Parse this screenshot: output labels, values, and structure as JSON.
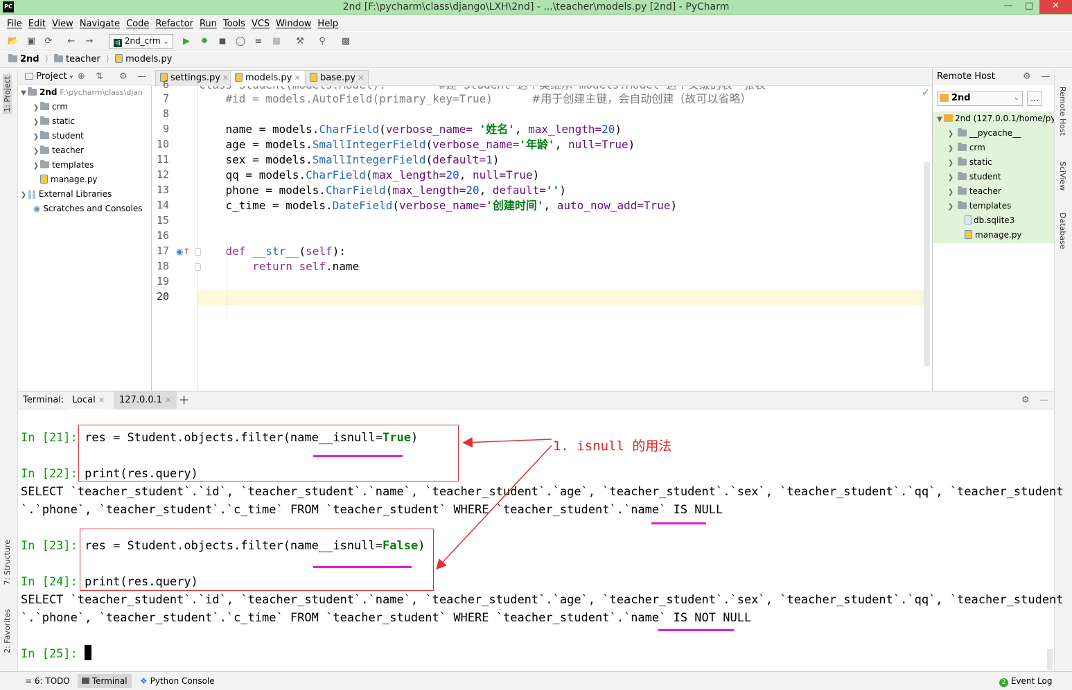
{
  "window": {
    "title": "2nd [F:\\pycharm\\class\\django\\LXH\\2nd] - ...\\teacher\\models.py [2nd] - PyCharm",
    "logo": "PC"
  },
  "menu": [
    "File",
    "Edit",
    "View",
    "Navigate",
    "Code",
    "Refactor",
    "Run",
    "Tools",
    "VCS",
    "Window",
    "Help"
  ],
  "toolbar": {
    "run_config": "2nd_crm"
  },
  "breadcrumb": [
    "2nd",
    "teacher",
    "models.py"
  ],
  "left_tool_tabs": [
    "1: Project",
    "7: Structure",
    "2: Favorites"
  ],
  "right_tool_tabs": [
    "Remote Host",
    "SciView",
    "Database"
  ],
  "project": {
    "header": "Project",
    "root": {
      "name": "2nd",
      "path": "F:\\pycharm\\class\\djan"
    },
    "items": [
      {
        "name": "crm",
        "type": "folder"
      },
      {
        "name": "static",
        "type": "folder"
      },
      {
        "name": "student",
        "type": "folder"
      },
      {
        "name": "teacher",
        "type": "folder"
      },
      {
        "name": "templates",
        "type": "folder"
      },
      {
        "name": "manage.py",
        "type": "file"
      }
    ],
    "external_libraries": "External Libraries",
    "scratches": "Scratches and Consoles"
  },
  "editor": {
    "tabs": [
      {
        "label": "settings.py",
        "active": false
      },
      {
        "label": "models.py",
        "active": true
      },
      {
        "label": "base.py",
        "active": false
      }
    ],
    "top_partial_line": "class Student(models.Model):        #建 Student 这个类继承 models.Model 这个父级的表一张表",
    "top_partial_number": "6",
    "line_numbers": [
      "7",
      "8",
      "9",
      "10",
      "11",
      "12",
      "13",
      "14",
      "15",
      "16",
      "17",
      "18",
      "19",
      "20"
    ],
    "lines": {
      "l7a": "    #id = models.AutoField(primary_key=True)",
      "l7b": "#用于创建主键，会自动创建（故可以省略）",
      "l9": [
        "    name = models.",
        "CharField",
        "(",
        "verbose_name=",
        " ",
        "'姓名'",
        ", ",
        "max_length=",
        "20",
        ")"
      ],
      "l10": [
        "    age = models.",
        "SmallIntegerField",
        "(",
        "verbose_name=",
        "'年龄'",
        ", ",
        "null=",
        "True",
        ")"
      ],
      "l11": [
        "    sex = models.",
        "SmallIntegerField",
        "(",
        "default=",
        "1",
        ")"
      ],
      "l12": [
        "    qq = models.",
        "CharField",
        "(",
        "max_length=",
        "20",
        ", ",
        "null=",
        "True",
        ")"
      ],
      "l13": [
        "    phone = models.",
        "CharField",
        "(",
        "max_length=",
        "20",
        ", ",
        "default=",
        "''",
        ")"
      ],
      "l14": [
        "    c_time = models.",
        "DateField",
        "(",
        "verbose_name=",
        "'创建时间'",
        ", ",
        "auto_now_add=",
        "True",
        ")"
      ],
      "l17": [
        "    ",
        "def",
        " ",
        "__str__",
        "(",
        "self",
        "):"
      ],
      "l18": [
        "        ",
        "return",
        " ",
        "self",
        ".name"
      ]
    }
  },
  "remote_host": {
    "header": "Remote Host",
    "server": "2nd",
    "root": "2nd (127.0.0.1/home/py",
    "items": [
      {
        "name": "__pycache__",
        "type": "folder"
      },
      {
        "name": "crm",
        "type": "folder"
      },
      {
        "name": "static",
        "type": "folder"
      },
      {
        "name": "student",
        "type": "folder"
      },
      {
        "name": "teacher",
        "type": "folder"
      },
      {
        "name": "templates",
        "type": "folder"
      },
      {
        "name": "db.sqlite3",
        "type": "file"
      },
      {
        "name": "manage.py",
        "type": "file"
      }
    ]
  },
  "terminal": {
    "label": "Terminal:",
    "tabs": [
      "Local",
      "127.0.0.1"
    ],
    "add": "+",
    "in21_prompt": "In [21]: ",
    "in21_code_a": "res = Student.objects.filter(name__isnull=",
    "in21_code_b": "True",
    "in21_code_c": ")",
    "in22_prompt": "In [22]: ",
    "in22_code": "print(res.query)",
    "out22_l1": "SELECT `teacher_student`.`id`, `teacher_student`.`name`, `teacher_student`.`age`, `teacher_student`.`sex`, `teacher_student`.`qq`, `teacher_student",
    "out22_l2": "`.`phone`, `teacher_student`.`c_time` FROM `teacher_student` WHERE `teacher_student`.`name` IS NULL",
    "in23_prompt": "In [23]: ",
    "in23_code_a": "res = Student.objects.filter(name__isnull=",
    "in23_code_b": "False",
    "in23_code_c": ")",
    "in24_prompt": "In [24]: ",
    "in24_code": "print(res.query)",
    "out24_l1": "SELECT `teacher_student`.`id`, `teacher_student`.`name`, `teacher_student`.`age`, `teacher_student`.`sex`, `teacher_student`.`qq`, `teacher_student",
    "out24_l2": "`.`phone`, `teacher_student`.`c_time` FROM `teacher_student` WHERE `teacher_student`.`name` IS NOT NULL",
    "in25_prompt": "In [25]: ",
    "annotation": "1. isnull 的用法"
  },
  "bottom_bar": {
    "todo": "6: TODO",
    "terminal": "Terminal",
    "python_console": "Python Console",
    "event_log": "Event Log",
    "event_count": "2"
  },
  "colors": {
    "titlebar": "#aee2ae",
    "remote_tree": "#e1f3d8",
    "prompt_green": "#0b9a0b",
    "annotation_red": "#e02222",
    "underline_magenta": "#e020e0"
  }
}
